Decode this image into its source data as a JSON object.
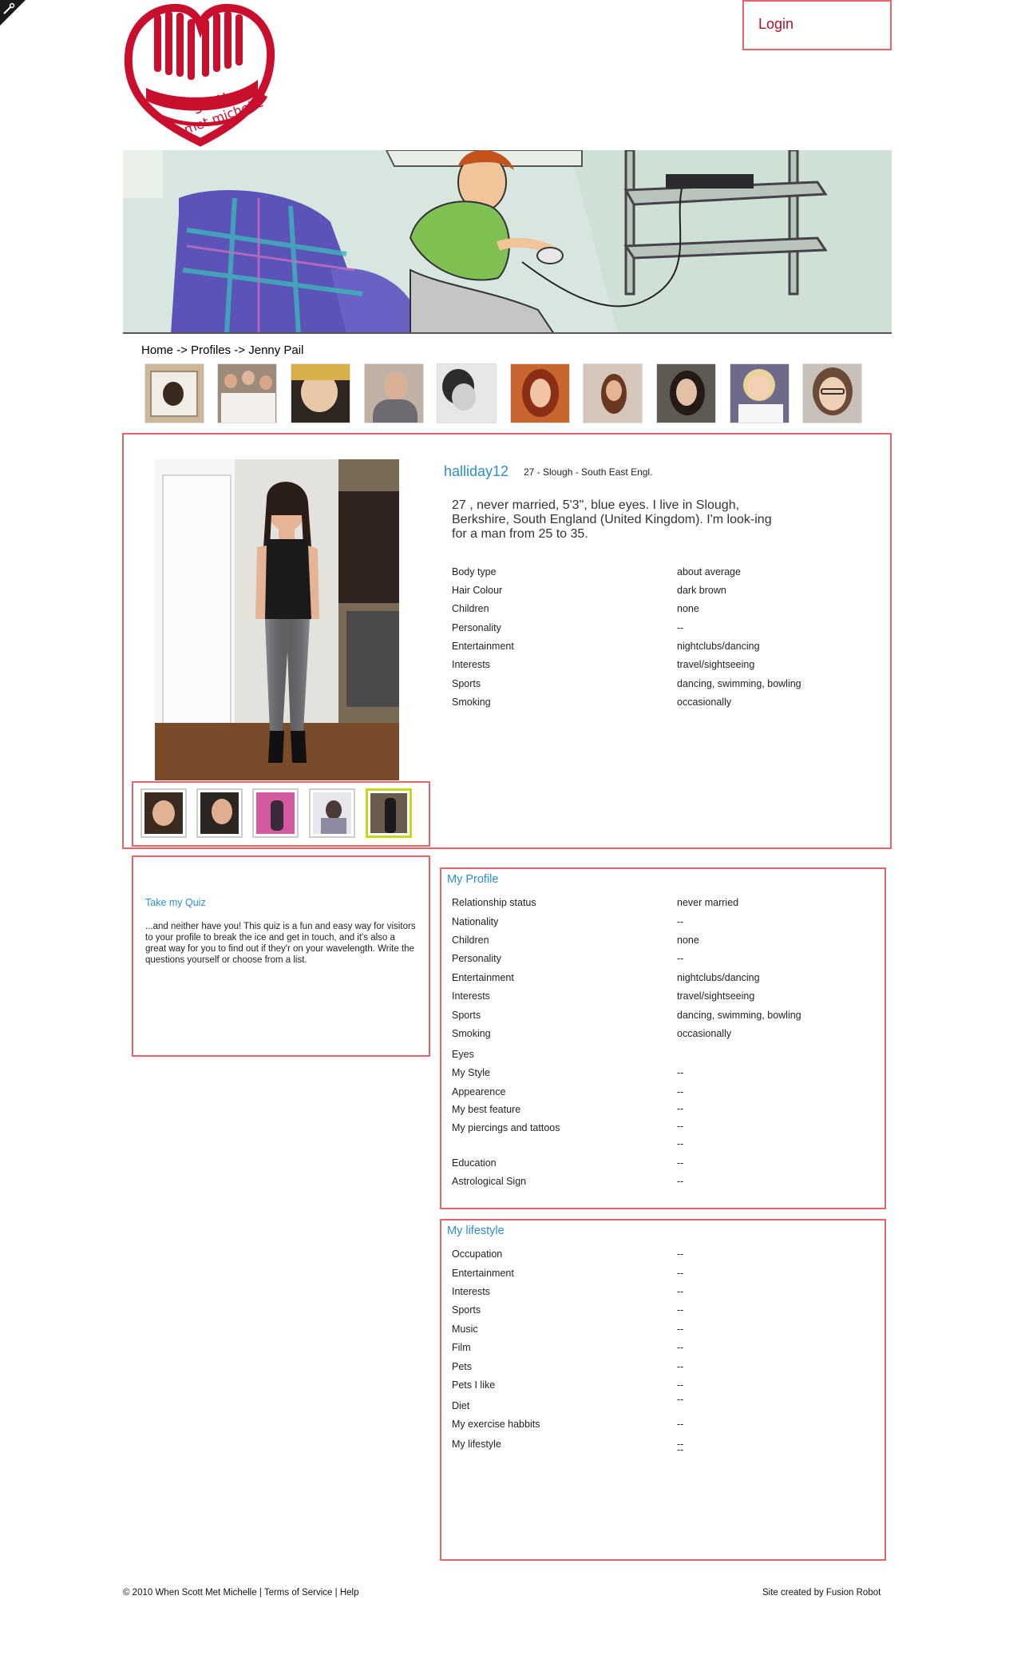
{
  "logo": {
    "lines": [
      "when",
      "scott",
      "met michelle"
    ]
  },
  "header": {
    "login_label": "Login"
  },
  "breadcrumb": {
    "home": "Home",
    "sep1": " -> ",
    "profiles": "Profiles",
    "sep2": " -> ",
    "current": "Jenny Pail"
  },
  "profile": {
    "username": "halliday12",
    "summary": "27 - Slough - South East Engl.",
    "bio": "27 , never married, 5'3\", blue eyes. I live in Slough, Berkshire, South England (United Kingdom). I'm look-ing for a man from 25 to 35.",
    "attributes": [
      {
        "label": "Body type",
        "value": "about average"
      },
      {
        "label": "Hair Colour",
        "value": "dark brown"
      },
      {
        "label": "Children",
        "value": "none"
      },
      {
        "label": "Personality",
        "value": "--"
      },
      {
        "label": "Entertainment",
        "value": "nightclubs/dancing"
      },
      {
        "label": "Interests",
        "value": "travel/sightseeing"
      },
      {
        "label": "Sports",
        "value": "dancing, swimming, bowling"
      },
      {
        "label": "Smoking",
        "value": "occasionally"
      }
    ]
  },
  "quiz": {
    "title": "Take my Quiz",
    "text": "...and neither have you! This quiz is a fun and easy way for visitors to your profile to break the ice and get in touch, and it's also a great way for you to find out if they'r on your wavelength. Write the questions yourself or choose from a list."
  },
  "my_profile": {
    "title": "My Profile",
    "labels": [
      "Relationship status",
      "Nationality",
      "Children",
      "Personality",
      "Entertainment",
      "Interests",
      "Sports",
      "Smoking",
      "Eyes",
      "My Style",
      "Appearence",
      "My best feature",
      "My piercings and tattoos",
      "Education",
      "Astrological Sign"
    ],
    "values": [
      "never married",
      "--",
      "none",
      "--",
      "nightclubs/dancing",
      "travel/sightseeing",
      "dancing, swimming, bowling",
      "occasionally",
      "--",
      "--",
      "--",
      "--",
      "--",
      "--",
      "--"
    ]
  },
  "my_lifestyle": {
    "title": "My lifestyle",
    "labels": [
      "Occupation",
      "Entertainment",
      "Interests",
      "Sports",
      "Music",
      "Film",
      "Pets",
      "Pets I like",
      "Diet",
      "My exercise habbits",
      "My lifestyle"
    ],
    "values": [
      "--",
      "--",
      "--",
      "--",
      "--",
      "--",
      "--",
      "--",
      "--",
      "--",
      "--",
      "--"
    ]
  },
  "footer": {
    "copyright": "© 2010 When Scott Met Michelle",
    "sep": " | ",
    "terms": "Terms of Service",
    "help": "Help",
    "credit": "Site created by Fusion Robot"
  },
  "colors": {
    "accent_red": "#c8102e",
    "box_border": "#e8646a",
    "link_blue": "#2a8fd0",
    "selected_thumb": "#c6d81a"
  }
}
